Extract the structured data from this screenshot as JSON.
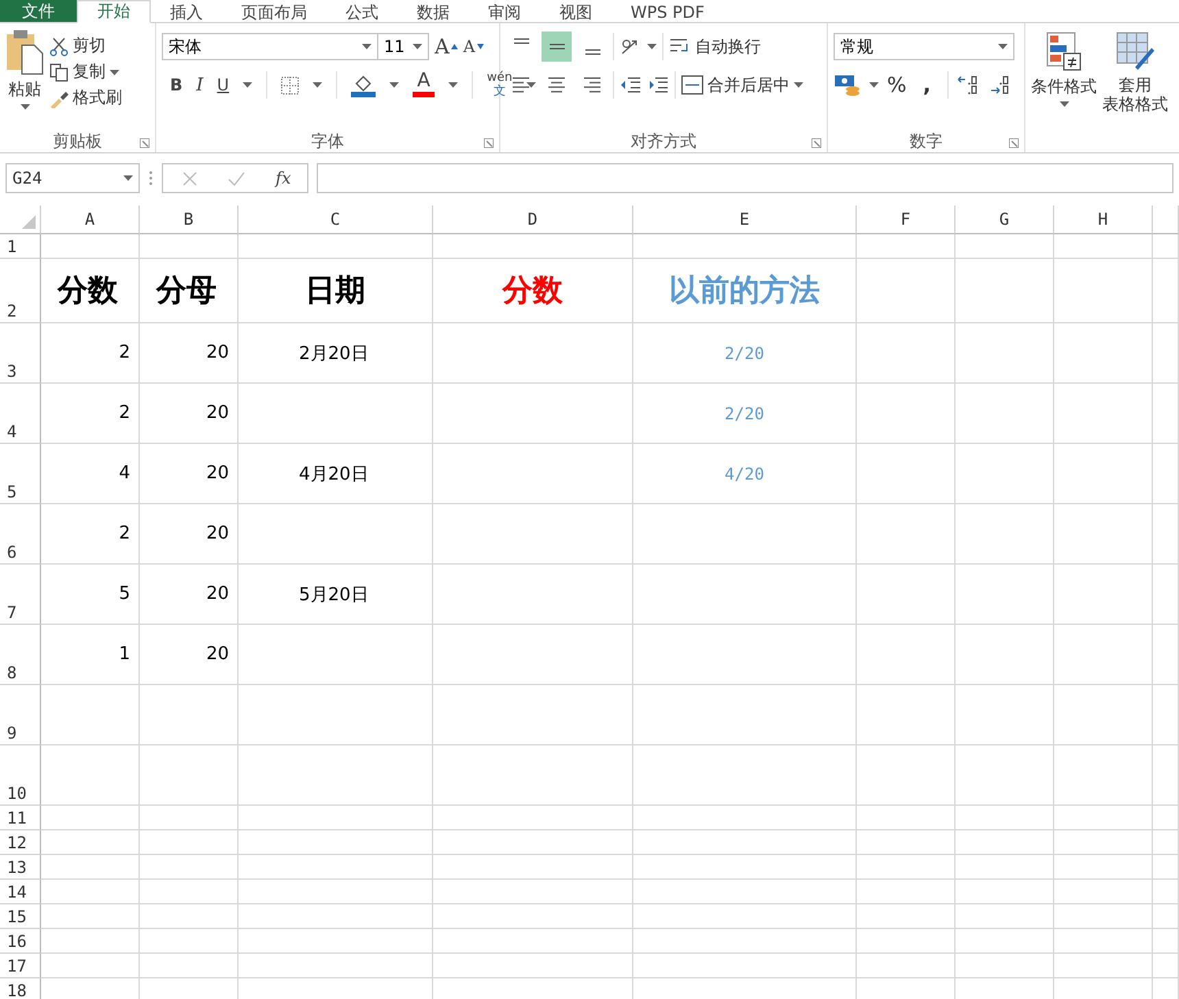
{
  "tabs": [
    {
      "label": "文件",
      "kind": "file",
      "selected": false
    },
    {
      "label": "开始",
      "kind": "tab",
      "selected": true
    },
    {
      "label": "插入",
      "kind": "tab",
      "selected": false
    },
    {
      "label": "页面布局",
      "kind": "tab",
      "selected": false
    },
    {
      "label": "公式",
      "kind": "tab",
      "selected": false
    },
    {
      "label": "数据",
      "kind": "tab",
      "selected": false
    },
    {
      "label": "审阅",
      "kind": "tab",
      "selected": false
    },
    {
      "label": "视图",
      "kind": "tab",
      "selected": false
    },
    {
      "label": "WPS PDF",
      "kind": "tab",
      "selected": false
    }
  ],
  "clipboard": {
    "label": "剪贴板",
    "paste": "粘贴",
    "cut": "剪切",
    "copy": "复制",
    "painter": "格式刷"
  },
  "font": {
    "label": "字体",
    "name": "宋体",
    "size": "11",
    "grow": "A",
    "shrink": "A",
    "bold": "B",
    "italic": "I",
    "underline": "U",
    "color_letter": "A",
    "phonetic_top": "wén",
    "phonetic_bottom": "文"
  },
  "alignment": {
    "label": "对齐方式",
    "vertical": [
      {
        "kind": "top",
        "selected": false
      },
      {
        "kind": "middle",
        "selected": true
      },
      {
        "kind": "bottom",
        "selected": false
      }
    ],
    "horizontal": [
      {
        "kind": "left",
        "selected": false
      },
      {
        "kind": "center",
        "selected": false
      },
      {
        "kind": "right",
        "selected": false
      }
    ],
    "wrap": "自动换行",
    "merge": "合并后居中"
  },
  "number": {
    "label": "数字",
    "format": "常规",
    "percent": "%",
    "comma": ","
  },
  "styles": {
    "conditional": "条件格式",
    "table_line1": "套用",
    "table_line2": "表格格式"
  },
  "formula_bar": {
    "name_box": "G24",
    "fx": "fx"
  },
  "columns": [
    "A",
    "B",
    "C",
    "D",
    "E",
    "F",
    "G",
    "H"
  ],
  "rows": [
    {
      "label": "1",
      "cells": {}
    },
    {
      "label": "2",
      "cells": {
        "A": {
          "text": "分数",
          "kind": "heading"
        },
        "B": {
          "text": "分母",
          "kind": "heading"
        },
        "C": {
          "text": "日期",
          "kind": "heading-center"
        },
        "D": {
          "text": "分数",
          "kind": "heading-center",
          "color": "#ff0000"
        },
        "E": {
          "text": "以前的方法",
          "kind": "heading-center",
          "color": "#5b9bd5"
        }
      }
    },
    {
      "label": "3",
      "cells": {
        "A": {
          "text": "2",
          "kind": "number"
        },
        "B": {
          "text": "20",
          "kind": "number"
        },
        "C": {
          "text": "2月20日",
          "kind": "date"
        },
        "E": {
          "text": "2/20",
          "kind": "fraction",
          "color": "#5b9bd5"
        }
      }
    },
    {
      "label": "4",
      "cells": {
        "A": {
          "text": "2",
          "kind": "number"
        },
        "B": {
          "text": "20",
          "kind": "number"
        },
        "E": {
          "text": "2/20",
          "kind": "fraction",
          "color": "#5b9bd5"
        }
      }
    },
    {
      "label": "5",
      "cells": {
        "A": {
          "text": "4",
          "kind": "number"
        },
        "B": {
          "text": "20",
          "kind": "number"
        },
        "C": {
          "text": "4月20日",
          "kind": "date"
        },
        "E": {
          "text": "4/20",
          "kind": "fraction",
          "color": "#5b9bd5"
        }
      }
    },
    {
      "label": "6",
      "cells": {
        "A": {
          "text": "2",
          "kind": "number"
        },
        "B": {
          "text": "20",
          "kind": "number"
        }
      }
    },
    {
      "label": "7",
      "cells": {
        "A": {
          "text": "5",
          "kind": "number"
        },
        "B": {
          "text": "20",
          "kind": "number"
        },
        "C": {
          "text": "5月20日",
          "kind": "date"
        }
      }
    },
    {
      "label": "8",
      "cells": {
        "A": {
          "text": "1",
          "kind": "number"
        },
        "B": {
          "text": "20",
          "kind": "number"
        }
      }
    },
    {
      "label": "9",
      "cells": {}
    },
    {
      "label": "10",
      "cells": {}
    },
    {
      "label": "11",
      "cells": {}
    },
    {
      "label": "12",
      "cells": {}
    },
    {
      "label": "13",
      "cells": {}
    },
    {
      "label": "14",
      "cells": {}
    },
    {
      "label": "15",
      "cells": {}
    },
    {
      "label": "16",
      "cells": {}
    },
    {
      "label": "17",
      "cells": {}
    },
    {
      "label": "18",
      "cells": {}
    }
  ]
}
